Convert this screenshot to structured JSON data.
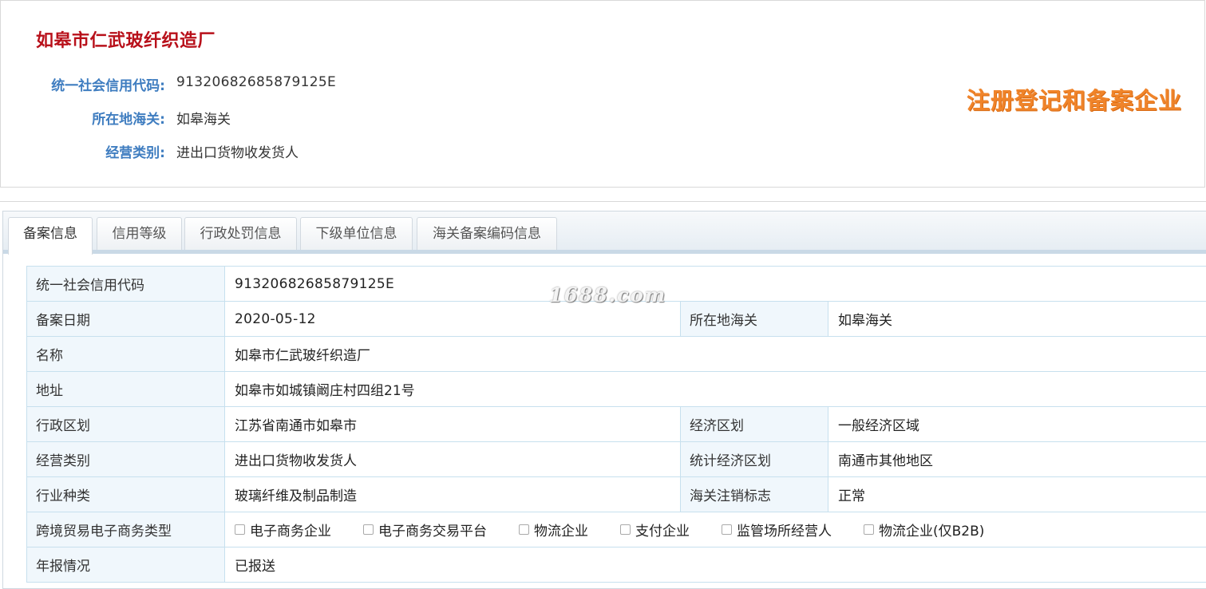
{
  "header": {
    "company_name": "如皋市仁武玻纤织造厂",
    "fields": [
      {
        "label": "统一社会信用代码:",
        "value": "91320682685879125E"
      },
      {
        "label": "所在地海关:",
        "value": "如皋海关"
      },
      {
        "label": "经营类别:",
        "value": "进出口货物收发货人"
      }
    ],
    "stamp": "注册登记和备案企业"
  },
  "tabs": [
    {
      "label": "备案信息",
      "active": true
    },
    {
      "label": "信用等级",
      "active": false
    },
    {
      "label": "行政处罚信息",
      "active": false
    },
    {
      "label": "下级单位信息",
      "active": false
    },
    {
      "label": "海关备案编码信息",
      "active": false
    }
  ],
  "watermark": "1688.com",
  "table": {
    "credit_code": {
      "label": "统一社会信用代码",
      "value": "91320682685879125E"
    },
    "record_date": {
      "label": "备案日期",
      "value": "2020-05-12"
    },
    "customs": {
      "label": "所在地海关",
      "value": "如皋海关"
    },
    "name": {
      "label": "名称",
      "value": "如皋市仁武玻纤织造厂"
    },
    "address": {
      "label": "地址",
      "value": "如皋市如城镇阚庄村四组21号"
    },
    "admin_region": {
      "label": "行政区划",
      "value": "江苏省南通市如皋市"
    },
    "economic_region": {
      "label": "经济区划",
      "value": "一般经济区域"
    },
    "business_type": {
      "label": "经营类别",
      "value": "进出口货物收发货人"
    },
    "stat_region": {
      "label": "统计经济区划",
      "value": "南通市其他地区"
    },
    "industry": {
      "label": "行业种类",
      "value": "玻璃纤维及制品制造"
    },
    "cancel_flag": {
      "label": "海关注销标志",
      "value": "正常"
    },
    "ecommerce_type": {
      "label": "跨境贸易电子商务类型",
      "options": [
        {
          "label": "电子商务企业",
          "checked": false
        },
        {
          "label": "电子商务交易平台",
          "checked": false
        },
        {
          "label": "物流企业",
          "checked": false
        },
        {
          "label": "支付企业",
          "checked": false
        },
        {
          "label": "监管场所经营人",
          "checked": false
        },
        {
          "label": "物流企业(仅B2B)",
          "checked": false
        }
      ]
    },
    "annual_report": {
      "label": "年报情况",
      "value": "已报送"
    }
  }
}
